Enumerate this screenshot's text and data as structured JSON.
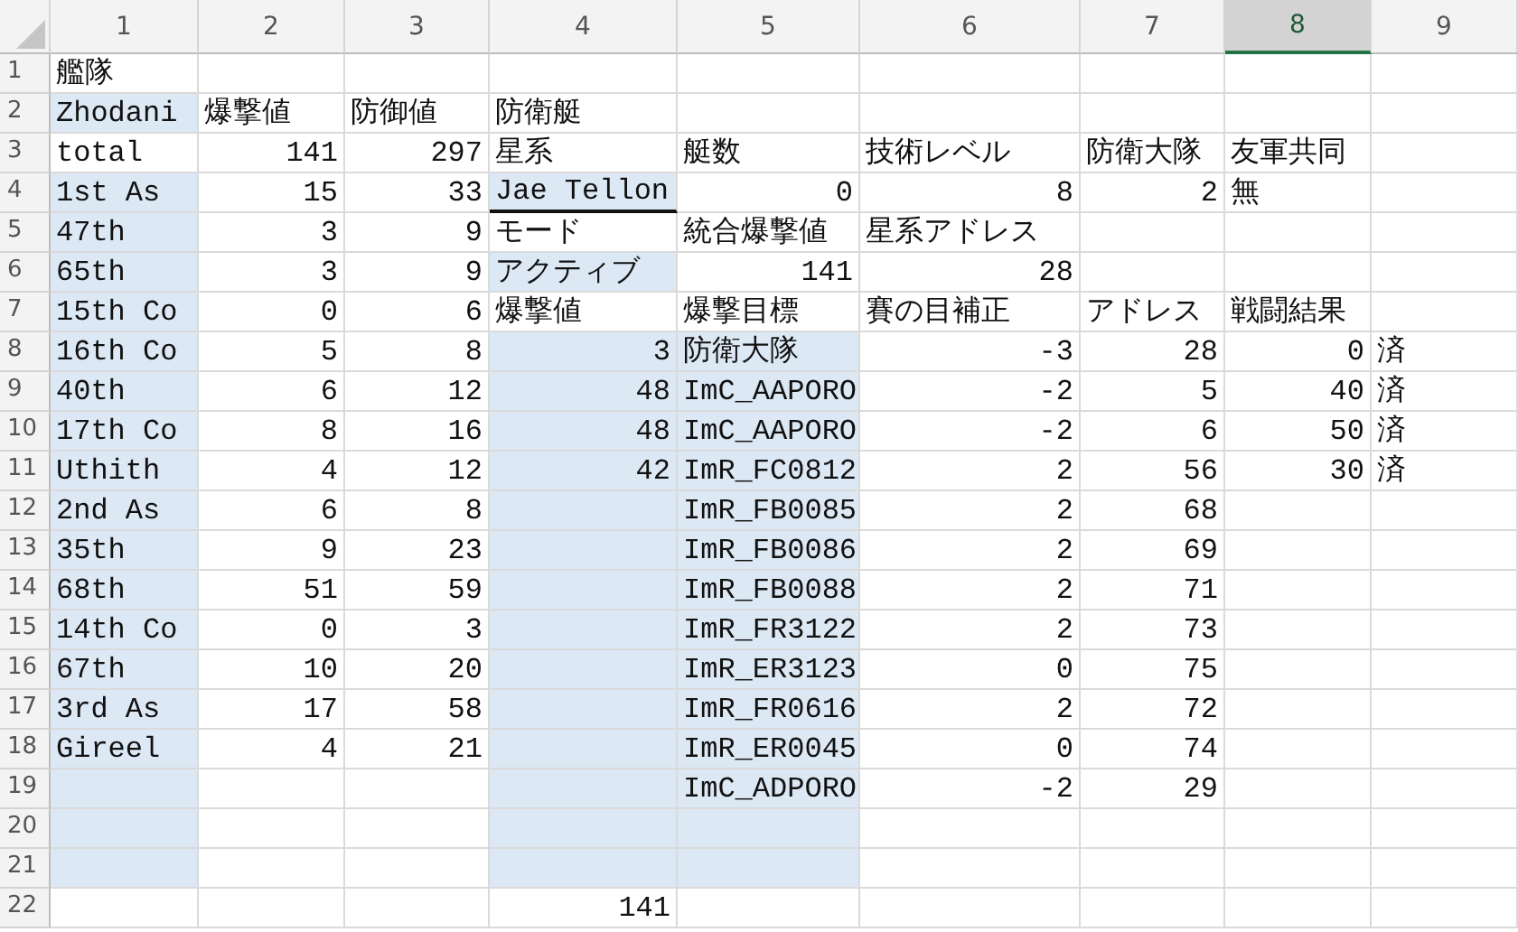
{
  "columns": [
    {
      "label": "1",
      "selected": false
    },
    {
      "label": "2",
      "selected": false
    },
    {
      "label": "3",
      "selected": false
    },
    {
      "label": "4",
      "selected": false
    },
    {
      "label": "5",
      "selected": false
    },
    {
      "label": "6",
      "selected": false
    },
    {
      "label": "7",
      "selected": false
    },
    {
      "label": "8",
      "selected": true
    },
    {
      "label": "9",
      "selected": false
    }
  ],
  "rows": [
    {
      "number": "1",
      "cells": [
        {
          "kind": "label",
          "text": "艦隊",
          "shaded": false
        },
        {
          "kind": "empty",
          "shaded": false
        },
        {
          "kind": "empty",
          "shaded": false
        },
        {
          "kind": "empty",
          "shaded": false
        },
        {
          "kind": "empty",
          "shaded": false
        },
        {
          "kind": "empty",
          "shaded": false
        },
        {
          "kind": "empty",
          "shaded": false
        },
        {
          "kind": "empty",
          "shaded": false
        },
        {
          "kind": "empty",
          "shaded": false
        }
      ]
    },
    {
      "number": "2",
      "cells": [
        {
          "kind": "label",
          "text": "Zhodani",
          "shaded": true
        },
        {
          "kind": "label",
          "text": "爆撃値",
          "shaded": false
        },
        {
          "kind": "label",
          "text": "防御値",
          "shaded": false
        },
        {
          "kind": "label",
          "text": "防衛艇",
          "shaded": false
        },
        {
          "kind": "empty",
          "shaded": false
        },
        {
          "kind": "empty",
          "shaded": false
        },
        {
          "kind": "empty",
          "shaded": false
        },
        {
          "kind": "empty",
          "shaded": false
        },
        {
          "kind": "empty",
          "shaded": false
        }
      ]
    },
    {
      "number": "3",
      "cells": [
        {
          "kind": "label",
          "text": "total",
          "shaded": false
        },
        {
          "kind": "number",
          "text": "141",
          "shaded": false
        },
        {
          "kind": "number",
          "text": "297",
          "shaded": false
        },
        {
          "kind": "label",
          "text": "星系",
          "shaded": false
        },
        {
          "kind": "label",
          "text": "艇数",
          "shaded": false
        },
        {
          "kind": "label",
          "text": "技術レベル",
          "shaded": false
        },
        {
          "kind": "label",
          "text": "防衛大隊",
          "shaded": false
        },
        {
          "kind": "label",
          "text": "友軍共同",
          "shaded": false
        },
        {
          "kind": "empty",
          "shaded": false
        }
      ]
    },
    {
      "number": "4",
      "cells": [
        {
          "kind": "label",
          "text": "1st As",
          "shaded": true
        },
        {
          "kind": "number",
          "text": "15",
          "shaded": false
        },
        {
          "kind": "number",
          "text": "33",
          "shaded": false
        },
        {
          "kind": "label",
          "text": "Jae Tellon",
          "shaded": true,
          "underlined": true
        },
        {
          "kind": "number",
          "text": "0",
          "shaded": false
        },
        {
          "kind": "number",
          "text": "8",
          "shaded": false
        },
        {
          "kind": "number",
          "text": "2",
          "shaded": false
        },
        {
          "kind": "label",
          "text": "無",
          "shaded": false
        },
        {
          "kind": "empty",
          "shaded": false
        }
      ]
    },
    {
      "number": "5",
      "cells": [
        {
          "kind": "label",
          "text": "47th",
          "shaded": true
        },
        {
          "kind": "number",
          "text": "3",
          "shaded": false
        },
        {
          "kind": "number",
          "text": "9",
          "shaded": false
        },
        {
          "kind": "label",
          "text": "モード",
          "shaded": false
        },
        {
          "kind": "label",
          "text": "統合爆撃値",
          "shaded": false
        },
        {
          "kind": "label",
          "text": "星系アドレス",
          "shaded": false
        },
        {
          "kind": "empty",
          "shaded": false
        },
        {
          "kind": "empty",
          "shaded": false
        },
        {
          "kind": "empty",
          "shaded": false
        }
      ]
    },
    {
      "number": "6",
      "cells": [
        {
          "kind": "label",
          "text": "65th",
          "shaded": true
        },
        {
          "kind": "number",
          "text": "3",
          "shaded": false
        },
        {
          "kind": "number",
          "text": "9",
          "shaded": false
        },
        {
          "kind": "label",
          "text": "アクティブ",
          "shaded": true
        },
        {
          "kind": "number",
          "text": "141",
          "shaded": false
        },
        {
          "kind": "number",
          "text": "28",
          "shaded": false
        },
        {
          "kind": "empty",
          "shaded": false
        },
        {
          "kind": "empty",
          "shaded": false
        },
        {
          "kind": "empty",
          "shaded": false
        }
      ]
    },
    {
      "number": "7",
      "cells": [
        {
          "kind": "label",
          "text": "15th Co",
          "shaded": true
        },
        {
          "kind": "number",
          "text": "0",
          "shaded": false
        },
        {
          "kind": "number",
          "text": "6",
          "shaded": false
        },
        {
          "kind": "label",
          "text": "爆撃値",
          "shaded": false
        },
        {
          "kind": "label",
          "text": "爆撃目標",
          "shaded": false
        },
        {
          "kind": "label",
          "text": "賽の目補正",
          "shaded": false
        },
        {
          "kind": "label",
          "text": "アドレス",
          "shaded": false
        },
        {
          "kind": "label",
          "text": "戦闘結果",
          "shaded": false
        },
        {
          "kind": "empty",
          "shaded": false
        }
      ]
    },
    {
      "number": "8",
      "cells": [
        {
          "kind": "label",
          "text": "16th Co",
          "shaded": true
        },
        {
          "kind": "number",
          "text": "5",
          "shaded": false
        },
        {
          "kind": "number",
          "text": "8",
          "shaded": false
        },
        {
          "kind": "number",
          "text": "3",
          "shaded": true
        },
        {
          "kind": "label",
          "text": "防衛大隊",
          "shaded": true
        },
        {
          "kind": "number",
          "text": "-3",
          "shaded": false
        },
        {
          "kind": "number",
          "text": "28",
          "shaded": false
        },
        {
          "kind": "number",
          "text": "0",
          "shaded": false
        },
        {
          "kind": "label",
          "text": "済",
          "shaded": false
        }
      ]
    },
    {
      "number": "9",
      "cells": [
        {
          "kind": "label",
          "text": "40th",
          "shaded": true
        },
        {
          "kind": "number",
          "text": "6",
          "shaded": false
        },
        {
          "kind": "number",
          "text": "12",
          "shaded": false
        },
        {
          "kind": "number",
          "text": "48",
          "shaded": true
        },
        {
          "kind": "label",
          "text": "ImC_AAPORO",
          "shaded": true
        },
        {
          "kind": "number",
          "text": "-2",
          "shaded": false
        },
        {
          "kind": "number",
          "text": "5",
          "shaded": false
        },
        {
          "kind": "number",
          "text": "40",
          "shaded": false
        },
        {
          "kind": "label",
          "text": "済",
          "shaded": false
        }
      ]
    },
    {
      "number": "10",
      "cells": [
        {
          "kind": "label",
          "text": "17th Co",
          "shaded": true
        },
        {
          "kind": "number",
          "text": "8",
          "shaded": false
        },
        {
          "kind": "number",
          "text": "16",
          "shaded": false
        },
        {
          "kind": "number",
          "text": "48",
          "shaded": true
        },
        {
          "kind": "label",
          "text": "ImC_AAPORO",
          "shaded": true
        },
        {
          "kind": "number",
          "text": "-2",
          "shaded": false
        },
        {
          "kind": "number",
          "text": "6",
          "shaded": false
        },
        {
          "kind": "number",
          "text": "50",
          "shaded": false
        },
        {
          "kind": "label",
          "text": "済",
          "shaded": false
        }
      ]
    },
    {
      "number": "11",
      "cells": [
        {
          "kind": "label",
          "text": "Uthith",
          "shaded": true
        },
        {
          "kind": "number",
          "text": "4",
          "shaded": false
        },
        {
          "kind": "number",
          "text": "12",
          "shaded": false
        },
        {
          "kind": "number",
          "text": "42",
          "shaded": true
        },
        {
          "kind": "label",
          "text": "ImR_FC0812",
          "shaded": true
        },
        {
          "kind": "number",
          "text": "2",
          "shaded": false
        },
        {
          "kind": "number",
          "text": "56",
          "shaded": false
        },
        {
          "kind": "number",
          "text": "30",
          "shaded": false
        },
        {
          "kind": "label",
          "text": "済",
          "shaded": false
        }
      ]
    },
    {
      "number": "12",
      "cells": [
        {
          "kind": "label",
          "text": "2nd As",
          "shaded": true
        },
        {
          "kind": "number",
          "text": "6",
          "shaded": false
        },
        {
          "kind": "number",
          "text": "8",
          "shaded": false
        },
        {
          "kind": "empty",
          "shaded": true
        },
        {
          "kind": "label",
          "text": "ImR_FB0085",
          "shaded": true
        },
        {
          "kind": "number",
          "text": "2",
          "shaded": false
        },
        {
          "kind": "number",
          "text": "68",
          "shaded": false
        },
        {
          "kind": "empty",
          "shaded": false
        },
        {
          "kind": "empty",
          "shaded": false
        }
      ]
    },
    {
      "number": "13",
      "cells": [
        {
          "kind": "label",
          "text": "35th",
          "shaded": true
        },
        {
          "kind": "number",
          "text": "9",
          "shaded": false
        },
        {
          "kind": "number",
          "text": "23",
          "shaded": false
        },
        {
          "kind": "empty",
          "shaded": true
        },
        {
          "kind": "label",
          "text": "ImR_FB0086",
          "shaded": true
        },
        {
          "kind": "number",
          "text": "2",
          "shaded": false
        },
        {
          "kind": "number",
          "text": "69",
          "shaded": false
        },
        {
          "kind": "empty",
          "shaded": false
        },
        {
          "kind": "empty",
          "shaded": false
        }
      ]
    },
    {
      "number": "14",
      "cells": [
        {
          "kind": "label",
          "text": "68th",
          "shaded": true
        },
        {
          "kind": "number",
          "text": "51",
          "shaded": false
        },
        {
          "kind": "number",
          "text": "59",
          "shaded": false
        },
        {
          "kind": "empty",
          "shaded": true
        },
        {
          "kind": "label",
          "text": "ImR_FB0088",
          "shaded": true
        },
        {
          "kind": "number",
          "text": "2",
          "shaded": false
        },
        {
          "kind": "number",
          "text": "71",
          "shaded": false
        },
        {
          "kind": "empty",
          "shaded": false
        },
        {
          "kind": "empty",
          "shaded": false
        }
      ]
    },
    {
      "number": "15",
      "cells": [
        {
          "kind": "label",
          "text": "14th Co",
          "shaded": true
        },
        {
          "kind": "number",
          "text": "0",
          "shaded": false
        },
        {
          "kind": "number",
          "text": "3",
          "shaded": false
        },
        {
          "kind": "empty",
          "shaded": true
        },
        {
          "kind": "label",
          "text": "ImR_FR3122",
          "shaded": true
        },
        {
          "kind": "number",
          "text": "2",
          "shaded": false
        },
        {
          "kind": "number",
          "text": "73",
          "shaded": false
        },
        {
          "kind": "empty",
          "shaded": false
        },
        {
          "kind": "empty",
          "shaded": false
        }
      ]
    },
    {
      "number": "16",
      "cells": [
        {
          "kind": "label",
          "text": "67th",
          "shaded": true
        },
        {
          "kind": "number",
          "text": "10",
          "shaded": false
        },
        {
          "kind": "number",
          "text": "20",
          "shaded": false
        },
        {
          "kind": "empty",
          "shaded": true
        },
        {
          "kind": "label",
          "text": "ImR_ER3123",
          "shaded": true
        },
        {
          "kind": "number",
          "text": "0",
          "shaded": false
        },
        {
          "kind": "number",
          "text": "75",
          "shaded": false
        },
        {
          "kind": "empty",
          "shaded": false
        },
        {
          "kind": "empty",
          "shaded": false
        }
      ]
    },
    {
      "number": "17",
      "cells": [
        {
          "kind": "label",
          "text": "3rd As",
          "shaded": true
        },
        {
          "kind": "number",
          "text": "17",
          "shaded": false
        },
        {
          "kind": "number",
          "text": "58",
          "shaded": false
        },
        {
          "kind": "empty",
          "shaded": true
        },
        {
          "kind": "label",
          "text": "ImR_FR0616",
          "shaded": true
        },
        {
          "kind": "number",
          "text": "2",
          "shaded": false
        },
        {
          "kind": "number",
          "text": "72",
          "shaded": false
        },
        {
          "kind": "empty",
          "shaded": false
        },
        {
          "kind": "empty",
          "shaded": false
        }
      ]
    },
    {
      "number": "18",
      "cells": [
        {
          "kind": "label",
          "text": "Gireel",
          "shaded": true
        },
        {
          "kind": "number",
          "text": "4",
          "shaded": false
        },
        {
          "kind": "number",
          "text": "21",
          "shaded": false
        },
        {
          "kind": "empty",
          "shaded": true
        },
        {
          "kind": "label",
          "text": "ImR_ER0045",
          "shaded": true
        },
        {
          "kind": "number",
          "text": "0",
          "shaded": false
        },
        {
          "kind": "number",
          "text": "74",
          "shaded": false
        },
        {
          "kind": "empty",
          "shaded": false
        },
        {
          "kind": "empty",
          "shaded": false
        }
      ]
    },
    {
      "number": "19",
      "cells": [
        {
          "kind": "empty",
          "shaded": true
        },
        {
          "kind": "empty",
          "shaded": false
        },
        {
          "kind": "empty",
          "shaded": false
        },
        {
          "kind": "empty",
          "shaded": true
        },
        {
          "kind": "label",
          "text": "ImC_ADPORO",
          "shaded": true
        },
        {
          "kind": "number",
          "text": "-2",
          "shaded": false
        },
        {
          "kind": "number",
          "text": "29",
          "shaded": false
        },
        {
          "kind": "empty",
          "shaded": false
        },
        {
          "kind": "empty",
          "shaded": false
        }
      ]
    },
    {
      "number": "20",
      "cells": [
        {
          "kind": "empty",
          "shaded": true
        },
        {
          "kind": "empty",
          "shaded": false
        },
        {
          "kind": "empty",
          "shaded": false
        },
        {
          "kind": "empty",
          "shaded": true
        },
        {
          "kind": "empty",
          "shaded": true
        },
        {
          "kind": "empty",
          "shaded": false
        },
        {
          "kind": "empty",
          "shaded": false
        },
        {
          "kind": "empty",
          "shaded": false
        },
        {
          "kind": "empty",
          "shaded": false
        }
      ]
    },
    {
      "number": "21",
      "cells": [
        {
          "kind": "empty",
          "shaded": true
        },
        {
          "kind": "empty",
          "shaded": false
        },
        {
          "kind": "empty",
          "shaded": false
        },
        {
          "kind": "empty",
          "shaded": true
        },
        {
          "kind": "empty",
          "shaded": true
        },
        {
          "kind": "empty",
          "shaded": false
        },
        {
          "kind": "empty",
          "shaded": false
        },
        {
          "kind": "empty",
          "shaded": false
        },
        {
          "kind": "empty",
          "shaded": false
        }
      ]
    },
    {
      "number": "22",
      "cells": [
        {
          "kind": "empty",
          "shaded": false
        },
        {
          "kind": "empty",
          "shaded": false
        },
        {
          "kind": "empty",
          "shaded": false
        },
        {
          "kind": "number",
          "text": "141",
          "shaded": false
        },
        {
          "kind": "empty",
          "shaded": false
        },
        {
          "kind": "empty",
          "shaded": false
        },
        {
          "kind": "empty",
          "shaded": false
        },
        {
          "kind": "empty",
          "shaded": false
        },
        {
          "kind": "empty",
          "shaded": false
        }
      ]
    }
  ]
}
